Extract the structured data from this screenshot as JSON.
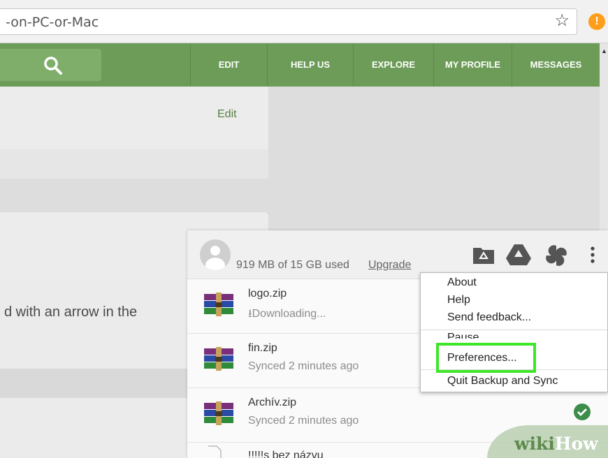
{
  "browser": {
    "url_fragment": "-on-PC-or-Mac",
    "star_icon": "star-outline-icon",
    "extension_icon": "alert-badge-icon",
    "extension_label": "!"
  },
  "site_nav": {
    "search_icon": "search-icon",
    "items": [
      "EDIT",
      "HELP US",
      "EXPLORE",
      "MY PROFILE",
      "MESSAGES"
    ]
  },
  "page": {
    "edit_link": "Edit",
    "body_text": "d with an arrow in the"
  },
  "backup_panel": {
    "storage_text": "919 MB of 15 GB used",
    "upgrade_link": "Upgrade",
    "icons": [
      "folder-icon",
      "drive-icon",
      "photos-icon",
      "more-vert-icon"
    ],
    "files": [
      {
        "name": "logo.zip",
        "status": "Downloading...",
        "status_icon": "download-icon"
      },
      {
        "name": "fin.zip",
        "status": "Synced 2 minutes ago"
      },
      {
        "name": "Archív.zip",
        "status": "Synced 2 minutes ago",
        "synced_check": true
      },
      {
        "name": "!!!!!s bez názvu",
        "status": ""
      }
    ]
  },
  "menu": {
    "items": [
      "About",
      "Help",
      "Send feedback...",
      "Pause",
      "Preferences...",
      "Quit Backup and Sync"
    ],
    "highlighted": "Preferences..."
  },
  "watermark": {
    "part1": "wiki",
    "part2": "How"
  },
  "colors": {
    "nav_green": "#6c9c58",
    "highlight_green": "#3ee62a",
    "synced_check": "#3c8c4a",
    "winrar_purple": "#7a2f7a",
    "winrar_green": "#2f8a3a",
    "winrar_blue": "#2a4aa8"
  }
}
